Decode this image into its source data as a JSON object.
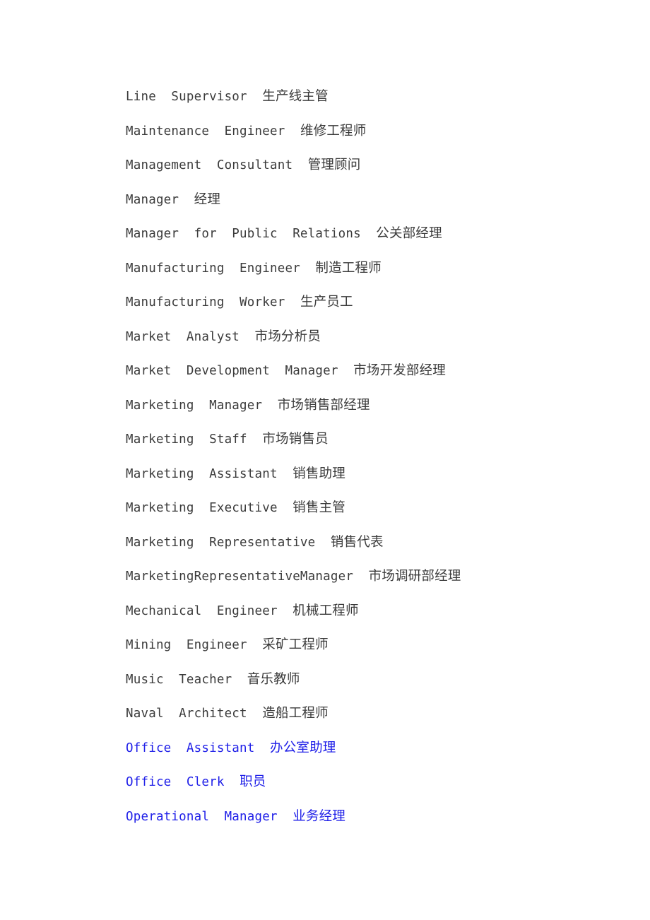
{
  "document": {
    "kind": "bilingual-glossary",
    "language_pair": "English-Chinese",
    "text_color": "#3b3b3b",
    "link_color": "#2020e8",
    "background_color": "#ffffff",
    "separator": "  "
  },
  "entries": [
    {
      "term": "Line  Supervisor",
      "gloss": "生产线主管",
      "style": "plain"
    },
    {
      "term": "Maintenance  Engineer",
      "gloss": "维修工程师",
      "style": "plain"
    },
    {
      "term": "Management  Consultant",
      "gloss": "管理顾问",
      "style": "plain"
    },
    {
      "term": "Manager",
      "gloss": "经理",
      "style": "plain"
    },
    {
      "term": "Manager  for  Public  Relations",
      "gloss": "公关部经理",
      "style": "plain"
    },
    {
      "term": "Manufacturing  Engineer",
      "gloss": "制造工程师",
      "style": "plain"
    },
    {
      "term": "Manufacturing  Worker",
      "gloss": "生产员工",
      "style": "plain"
    },
    {
      "term": "Market  Analyst",
      "gloss": "市场分析员",
      "style": "plain"
    },
    {
      "term": "Market  Development  Manager",
      "gloss": "市场开发部经理",
      "style": "plain"
    },
    {
      "term": "Marketing  Manager",
      "gloss": "市场销售部经理",
      "style": "plain"
    },
    {
      "term": "Marketing  Staff",
      "gloss": "市场销售员",
      "style": "plain"
    },
    {
      "term": "Marketing  Assistant",
      "gloss": "销售助理",
      "style": "plain"
    },
    {
      "term": "Marketing  Executive",
      "gloss": "销售主管",
      "style": "plain"
    },
    {
      "term": "Marketing  Representative",
      "gloss": "销售代表",
      "style": "plain"
    },
    {
      "term": "MarketingRepresentativeManager",
      "gloss": "市场调研部经理",
      "style": "plain"
    },
    {
      "term": "Mechanical  Engineer",
      "gloss": "机械工程师",
      "style": "plain"
    },
    {
      "term": "Mining  Engineer",
      "gloss": "采矿工程师",
      "style": "plain"
    },
    {
      "term": "Music  Teacher",
      "gloss": "音乐教师",
      "style": "plain"
    },
    {
      "term": "Naval  Architect",
      "gloss": "造船工程师",
      "style": "plain"
    },
    {
      "term": "Office  Assistant",
      "gloss": "办公室助理",
      "style": "link"
    },
    {
      "term": "Office  Clerk",
      "gloss": "职员",
      "style": "link"
    },
    {
      "term": "Operational  Manager",
      "gloss": "业务经理",
      "style": "link"
    }
  ]
}
